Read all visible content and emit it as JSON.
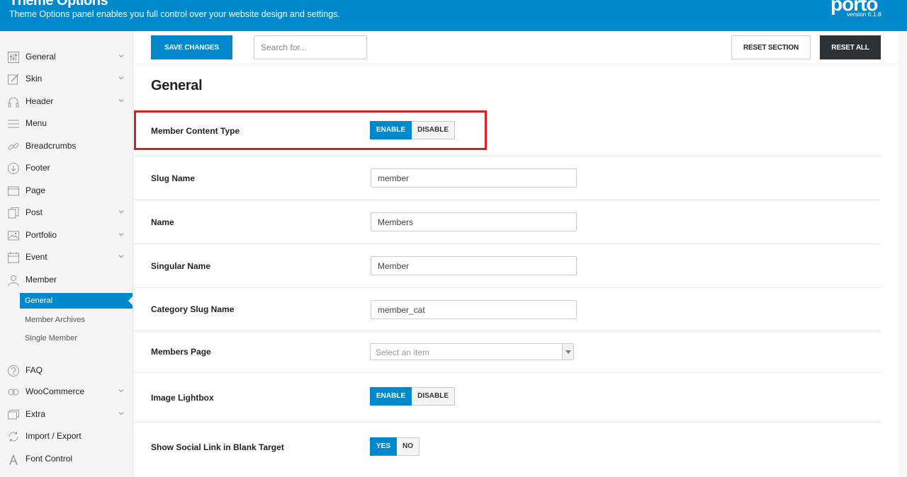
{
  "header": {
    "title": "Theme Options",
    "subtitle": "Theme Options panel enables you full control over your website design and settings.",
    "logo": "porto",
    "version": "version 6.1.8"
  },
  "sidebar": {
    "items": [
      {
        "label": "General",
        "icon": "sliders-icon",
        "chevron": true
      },
      {
        "label": "Skin",
        "icon": "paint-icon",
        "chevron": true
      },
      {
        "label": "Header",
        "icon": "headphones-icon",
        "chevron": true
      },
      {
        "label": "Menu",
        "icon": "menu-icon",
        "chevron": false
      },
      {
        "label": "Breadcrumbs",
        "icon": "link-icon",
        "chevron": false
      },
      {
        "label": "Footer",
        "icon": "arrow-down-circle-icon",
        "chevron": false
      },
      {
        "label": "Page",
        "icon": "page-icon",
        "chevron": false
      },
      {
        "label": "Post",
        "icon": "copy-icon",
        "chevron": true
      },
      {
        "label": "Portfolio",
        "icon": "image-icon",
        "chevron": true
      },
      {
        "label": "Event",
        "icon": "calendar-icon",
        "chevron": true
      },
      {
        "label": "Member",
        "icon": "user-icon",
        "chevron": false
      }
    ],
    "member_subitems": [
      {
        "label": "General"
      },
      {
        "label": "Member Archives"
      },
      {
        "label": "Single Member"
      }
    ],
    "items_bottom": [
      {
        "label": "FAQ",
        "icon": "question-icon",
        "chevron": false
      },
      {
        "label": "WooCommerce",
        "icon": "cart-icon",
        "chevron": true
      },
      {
        "label": "Extra",
        "icon": "layers-icon",
        "chevron": true
      },
      {
        "label": "Import / Export",
        "icon": "refresh-icon",
        "chevron": false
      },
      {
        "label": "Font Control",
        "icon": "font-icon",
        "chevron": false
      }
    ]
  },
  "toolbar": {
    "save_label": "SAVE CHANGES",
    "search_placeholder": "Search for...",
    "reset_section_label": "RESET SECTION",
    "reset_all_label": "RESET ALL"
  },
  "main": {
    "section_title": "General",
    "fields": {
      "member_content_type": {
        "label": "Member Content Type",
        "enable": "ENABLE",
        "disable": "DISABLE",
        "selected": "ENABLE"
      },
      "slug_name": {
        "label": "Slug Name",
        "value": "member"
      },
      "name": {
        "label": "Name",
        "value": "Members"
      },
      "singular_name": {
        "label": "Singular Name",
        "value": "Member"
      },
      "category_slug_name": {
        "label": "Category Slug Name",
        "value": "member_cat"
      },
      "members_page": {
        "label": "Members Page",
        "placeholder": "Select an item"
      },
      "image_lightbox": {
        "label": "Image Lightbox",
        "enable": "ENABLE",
        "disable": "DISABLE",
        "selected": "ENABLE"
      },
      "social_blank": {
        "label": "Show Social Link in Blank Target",
        "yes": "YES",
        "no": "NO",
        "selected": "YES"
      }
    }
  },
  "colors": {
    "accent": "#0088cc",
    "dark_button": "#2d3237",
    "highlight": "#e01b24"
  }
}
